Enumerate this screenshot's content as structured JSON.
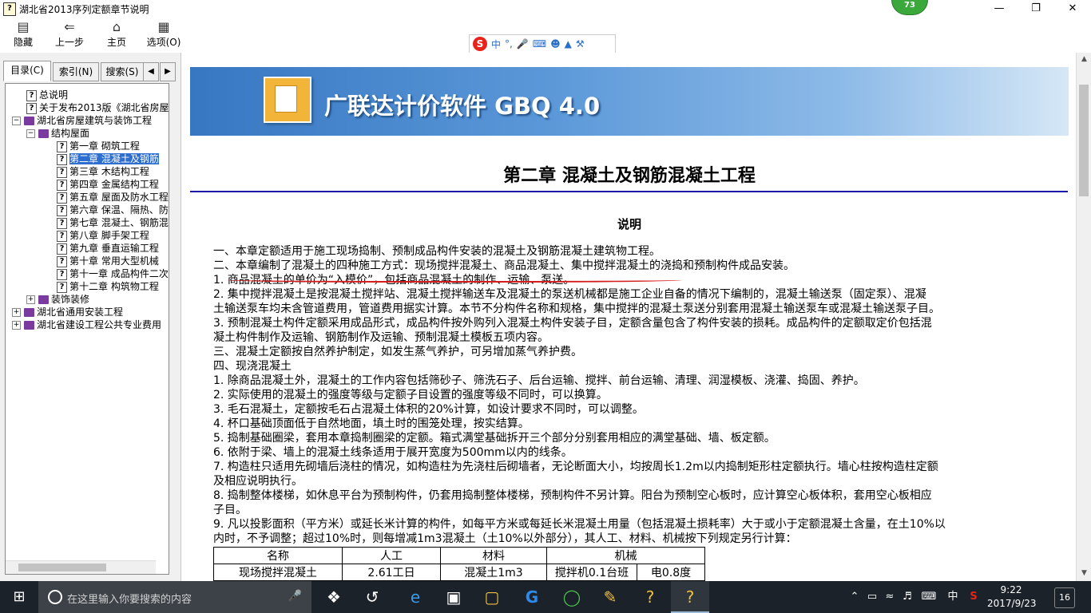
{
  "window": {
    "title": "湖北省2013序列定额章节说明",
    "update_badge": "73",
    "minimize_icon": "minimize",
    "maximize_icon": "restore",
    "close_icon": "close"
  },
  "toolbar": {
    "buttons": [
      {
        "label": "隐藏",
        "icon": "hide-icon"
      },
      {
        "label": "上一步",
        "icon": "back-arrow-icon"
      },
      {
        "label": "主页",
        "icon": "home-icon"
      },
      {
        "label": "选项(O)",
        "icon": "options-icon"
      }
    ]
  },
  "ime": {
    "lang": "中",
    "punct": "°,"
  },
  "left_tabs": [
    {
      "label": "目录(C)",
      "active": true
    },
    {
      "label": "索引(N)",
      "active": false
    },
    {
      "label": "搜索(S)",
      "active": false
    }
  ],
  "tree": [
    {
      "label": "总说明",
      "type": "doc",
      "level": 0
    },
    {
      "label": "关于发布2013版《湖北省房屋",
      "type": "doc",
      "level": 0
    },
    {
      "label": "湖北省房屋建筑与装饰工程",
      "type": "book",
      "level": 0,
      "expander": "−"
    },
    {
      "label": "结构屋面",
      "type": "book",
      "level": 1,
      "expander": "−"
    },
    {
      "label": "第一章 砌筑工程",
      "type": "doc",
      "level": 2
    },
    {
      "label": "第二章 混凝土及钢筋",
      "type": "doc",
      "level": 2,
      "selected": true
    },
    {
      "label": "第三章 木结构工程",
      "type": "doc",
      "level": 2
    },
    {
      "label": "第四章 金属结构工程",
      "type": "doc",
      "level": 2
    },
    {
      "label": "第五章 屋面及防水工程",
      "type": "doc",
      "level": 2
    },
    {
      "label": "第六章 保温、隔热、防",
      "type": "doc",
      "level": 2
    },
    {
      "label": "第七章 混凝土、钢筋混",
      "type": "doc",
      "level": 2
    },
    {
      "label": "第八章 脚手架工程",
      "type": "doc",
      "level": 2
    },
    {
      "label": "第九章 垂直运输工程",
      "type": "doc",
      "level": 2
    },
    {
      "label": "第十章 常用大型机械",
      "type": "doc",
      "level": 2
    },
    {
      "label": "第十一章 成品构件二次",
      "type": "doc",
      "level": 2
    },
    {
      "label": "第十二章 构筑物工程",
      "type": "doc",
      "level": 2
    },
    {
      "label": "装饰装修",
      "type": "book",
      "level": 1,
      "expander": "+"
    },
    {
      "label": "湖北省通用安装工程",
      "type": "book",
      "level": 0,
      "expander": "+"
    },
    {
      "label": "湖北省建设工程公共专业费用",
      "type": "book",
      "level": 0,
      "expander": "+"
    }
  ],
  "banner": {
    "text": "广联达计价软件 GBQ 4.0"
  },
  "doc": {
    "chapter_title": "第二章  混凝土及钢筋混凝土工程",
    "heading": "说明",
    "lines": [
      "一、本章定额适用于施工现场捣制、预制成品构件安装的混凝土及钢筋混凝土建筑物工程。",
      "二、本章编制了混凝土的四种施工方式：现场搅拌混凝土、商品混凝土、集中搅拌混凝土的浇捣和预制构件成品安装。",
      "1. 商品混凝土的单价为“入模价”，包括商品混凝土的制作、运输、泵送。",
      "2. 集中搅拌混凝土是按混凝土搅拌站、混凝土搅拌输送车及混凝土的泵送机械都是施工企业自备的情况下编制的，混凝土输送泵（固定泵）、混凝",
      "土输送泵车均未含管道费用，管道费用据实计算。本节不分构件名称和规格，集中搅拌的混凝土泵送分别套用混凝土输送泵车或混凝土输送泵子目。",
      "3. 预制混凝土构件定额采用成品形式，成品构件按外购列入混凝土构件安装子目，定额含量包含了构件安装的损耗。成品构件的定额取定价包括混",
      "凝土构件制作及运输、钢筋制作及运输、预制混凝土模板五项内容。",
      "三、混凝土定额按自然养护制定，如发生蒸气养护，可另增加蒸气养护费。",
      "四、现浇混凝土",
      "1. 除商品混凝土外，混凝土的工作内容包括筛砂子、筛洗石子、后台运输、搅拌、前台运输、清理、润湿模板、浇灌、捣固、养护。",
      "2. 实际使用的混凝土的强度等级与定额子目设置的强度等级不同时，可以换算。",
      "3. 毛石混凝土，定额按毛石占混凝土体积的20%计算，如设计要求不同时，可以调整。",
      "4. 杯口基础顶面低于自然地面，填土时的围笼处理，按实结算。",
      "5. 捣制基础圈梁，套用本章捣制圈梁的定额。箱式满堂基础拆开三个部分分别套用相应的满堂基础、墙、板定额。",
      "6. 依附于梁、墙上的混凝土线条适用于展开宽度为500mm以内的线条。",
      "7. 构造柱只适用先砌墙后浇柱的情况，如构造柱为先浇柱后砌墙者，无论断面大小，均按周长1.2m以内捣制矩形柱定额执行。墙心柱按构造柱定额",
      "及相应说明执行。",
      "8. 捣制整体楼梯，如休息平台为预制构件，仍套用捣制整体楼梯，预制构件不另计算。阳台为预制空心板时，应计算空心板体积，套用空心板相应",
      "子目。",
      "9. 凡以投影面积（平方米）或延长米计算的构件，如每平方米或每延长米混凝土用量（包括混凝土损耗率）大于或小于定额混凝土含量，在土10%以",
      "内时，不予调整；超过10%时，则每增减1m3混凝土（土10%以外部分），其人工、材料、机械按下列规定另行计算："
    ],
    "table": {
      "headers": [
        "名称",
        "人工",
        "材料",
        "机械"
      ],
      "row": [
        "现场搅拌混凝土",
        "2.61工日",
        "混凝土1m3",
        "搅拌机0.1台班",
        "电0.8度"
      ]
    }
  },
  "taskbar": {
    "search_placeholder": "在这里输入你要搜索的内容",
    "time": "9:22",
    "date": "2017/9/23",
    "ime_lang": "中",
    "notifications": "16"
  },
  "colors": {
    "accent": "#2d6ed0",
    "rule": "#1a1aa6",
    "red_annotation": "#d41d1d",
    "taskbar": "#1b2229"
  }
}
